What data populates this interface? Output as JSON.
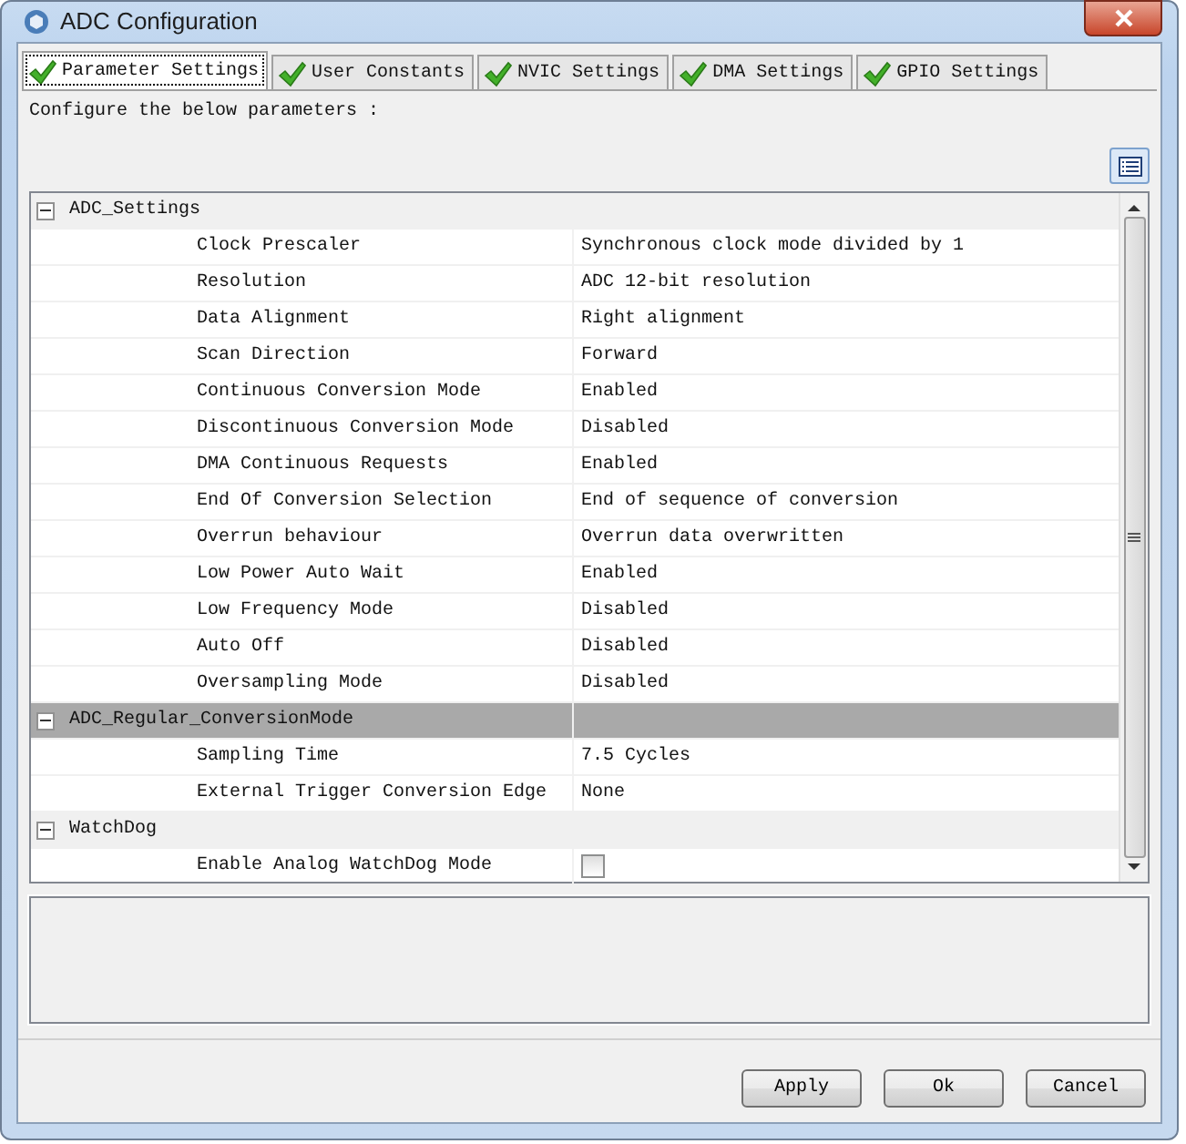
{
  "window": {
    "title": "ADC Configuration"
  },
  "tabs": [
    {
      "label": "Parameter Settings",
      "selected": true
    },
    {
      "label": "User Constants",
      "selected": false
    },
    {
      "label": "NVIC Settings",
      "selected": false
    },
    {
      "label": "DMA Settings",
      "selected": false
    },
    {
      "label": "GPIO Settings",
      "selected": false
    }
  ],
  "instruction": "Configure the below parameters :",
  "groups": [
    {
      "name": "ADC_Settings",
      "expanded": true,
      "selected": false,
      "parameters": [
        {
          "kind": "text",
          "name": "Clock Prescaler",
          "value": "Synchronous clock mode divided by 1"
        },
        {
          "kind": "text",
          "name": "Resolution",
          "value": "ADC 12-bit resolution"
        },
        {
          "kind": "text",
          "name": "Data Alignment",
          "value": "Right alignment"
        },
        {
          "kind": "text",
          "name": "Scan Direction",
          "value": "Forward"
        },
        {
          "kind": "text",
          "name": "Continuous Conversion Mode",
          "value": "Enabled"
        },
        {
          "kind": "text",
          "name": "Discontinuous Conversion Mode",
          "value": "Disabled"
        },
        {
          "kind": "text",
          "name": "DMA Continuous Requests",
          "value": "Enabled"
        },
        {
          "kind": "text",
          "name": "End Of Conversion Selection",
          "value": "End of sequence of conversion"
        },
        {
          "kind": "text",
          "name": "Overrun behaviour",
          "value": "Overrun data overwritten"
        },
        {
          "kind": "text",
          "name": "Low Power Auto Wait",
          "value": "Enabled"
        },
        {
          "kind": "text",
          "name": "Low Frequency Mode",
          "value": "Disabled"
        },
        {
          "kind": "text",
          "name": "Auto Off",
          "value": "Disabled"
        },
        {
          "kind": "text",
          "name": "Oversampling Mode",
          "value": "Disabled"
        }
      ]
    },
    {
      "name": "ADC_Regular_ConversionMode",
      "expanded": true,
      "selected": true,
      "parameters": [
        {
          "kind": "text",
          "name": "Sampling Time",
          "value": "7.5 Cycles"
        },
        {
          "kind": "text",
          "name": "External Trigger Conversion Edge",
          "value": "None"
        }
      ]
    },
    {
      "name": "WatchDog",
      "expanded": true,
      "selected": false,
      "parameters": [
        {
          "kind": "checkbox",
          "name": "Enable Analog WatchDog Mode",
          "checked": false
        }
      ]
    }
  ],
  "buttons": [
    "Apply",
    "Ok",
    "Cancel"
  ]
}
